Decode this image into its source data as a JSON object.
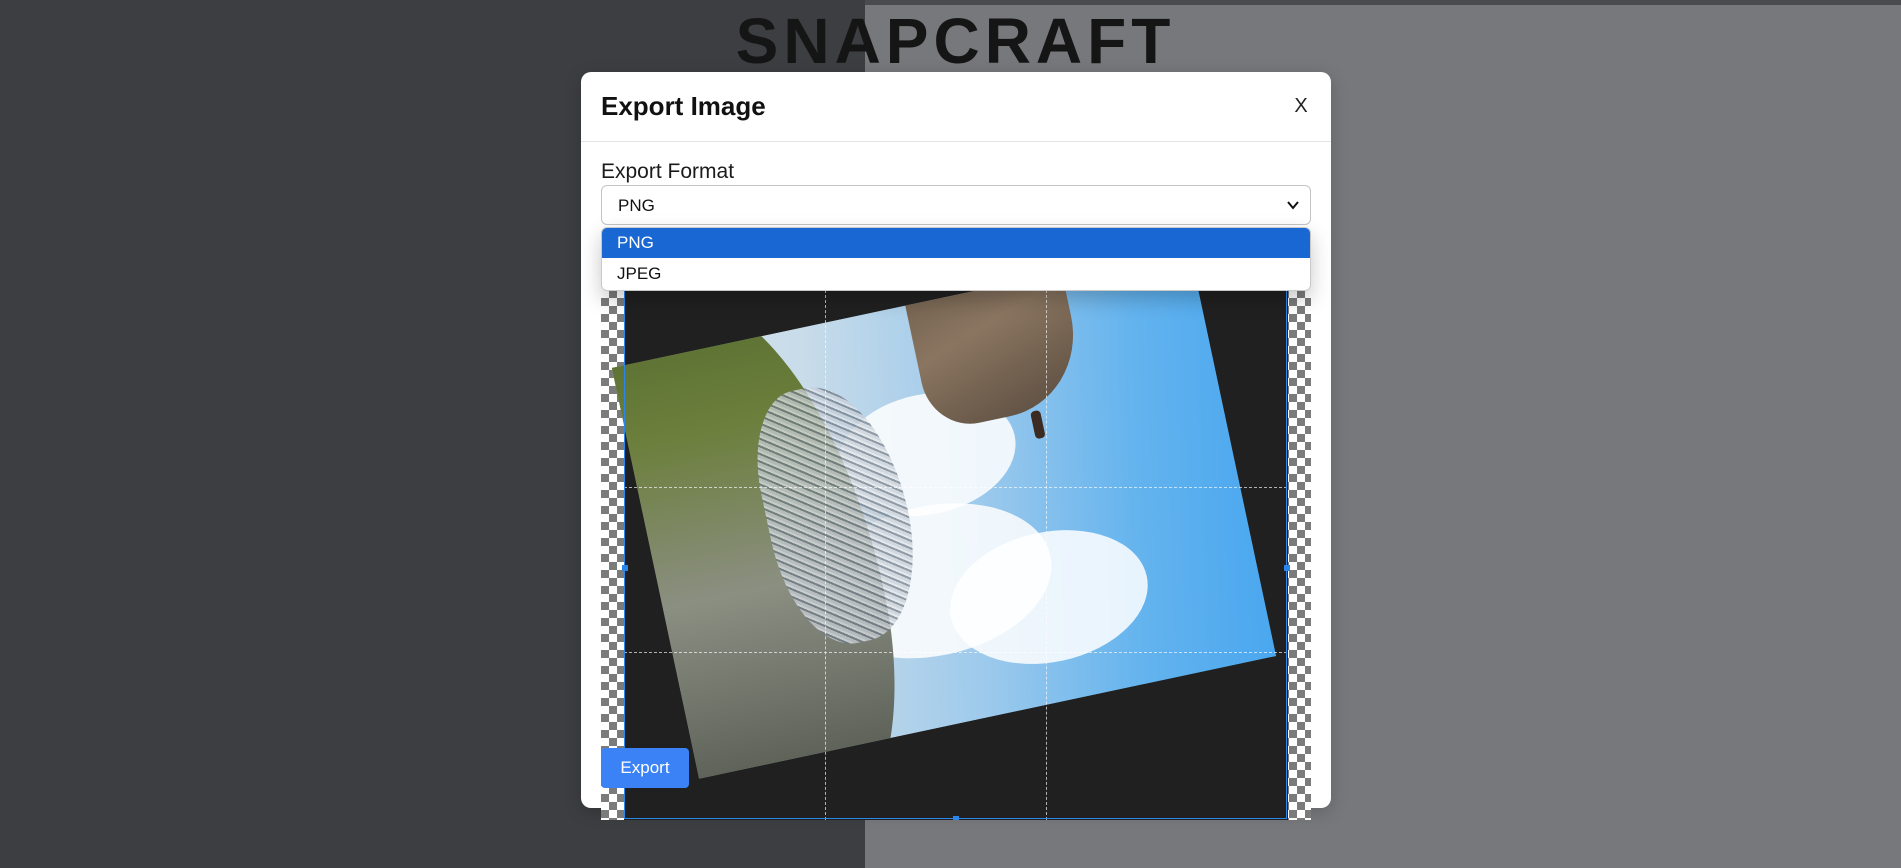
{
  "app": {
    "brand": "SNAPCRAFT"
  },
  "modal": {
    "title": "Export Image",
    "close_label": "X",
    "format_label": "Export Format",
    "format_selected": "PNG",
    "format_options": [
      "PNG",
      "JPEG"
    ],
    "export_label": "Export"
  },
  "colors": {
    "accent": "#3b82f6",
    "option_highlight": "#1967d2",
    "crop_guide": "#2b86e8"
  },
  "icons": {
    "close": "close-icon",
    "select_chevron": "chevron-down-icon"
  }
}
